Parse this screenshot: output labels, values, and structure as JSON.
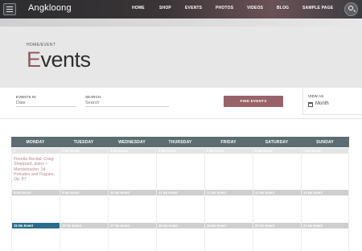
{
  "header": {
    "brand": "Angkloong",
    "nav": [
      "HOME",
      "SHOP",
      "EVENTS",
      "PHOTOS",
      "VIDEOS",
      "BLOG",
      "SAMPLE PAGE"
    ]
  },
  "hero": {
    "breadcrumb": "HOME/EVENT",
    "title_first": "E",
    "title_rest": "vents"
  },
  "filters": {
    "events_in_label": "EVENTS IN",
    "events_in_placeholder": "Date",
    "search_label": "SEARCH",
    "search_placeholder": "Search",
    "find_button": "FIND EVENTS",
    "view_as_label": "VIEW AS",
    "view_as_value": "Month"
  },
  "calendar": {
    "weekdays": [
      "MONDAY",
      "TUESDAY",
      "WEDNESDAY",
      "THURSDAY",
      "FRIDAY",
      "SATURDAY",
      "SUNDAY"
    ],
    "week1": [
      "1",
      "2 No Event",
      "3 No Event",
      "4 No Event",
      "5 No Event",
      "6 No Event",
      "7 No Event"
    ],
    "week2": [
      "8 No Event",
      "9 No Event",
      "10 No Event",
      "11 No Event",
      "12 No Event",
      "13 No Event",
      "14 No Event"
    ],
    "week3": [
      "15 No Event",
      "16 No Event",
      "17 No Event",
      "18 No Event",
      "19 No Event",
      "20 No Event",
      "21 No Event"
    ],
    "event_day1": "Fiorella Recital: Craig Sheppard, piano – Mendelssohn: 24 Preludes and Fugues, Op. 87"
  },
  "colors": {
    "accent": "#976368",
    "calendar_header": "#5b6d70",
    "today": "#2b6d8a"
  }
}
